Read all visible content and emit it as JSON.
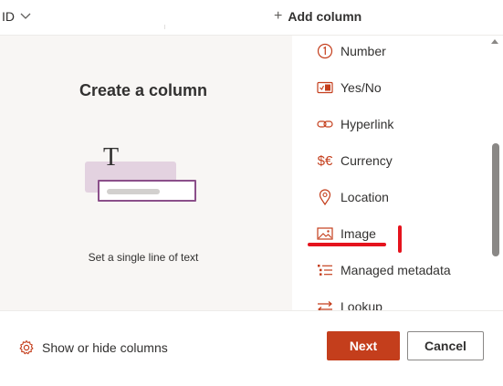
{
  "header": {
    "id_column": "ID",
    "add_column_label": "Add column",
    "add_column_icon": "plus-icon"
  },
  "preview": {
    "title": "Create a column",
    "glyph": "T",
    "description": "Set a single line of text"
  },
  "column_types": [
    {
      "label": "Number",
      "icon": "number-circle-icon"
    },
    {
      "label": "Yes/No",
      "icon": "yes-no-toggle-icon"
    },
    {
      "label": "Hyperlink",
      "icon": "link-icon"
    },
    {
      "label": "Currency",
      "icon": "currency-icon"
    },
    {
      "label": "Location",
      "icon": "location-pin-icon"
    },
    {
      "label": "Image",
      "icon": "image-icon"
    },
    {
      "label": "Managed metadata",
      "icon": "managed-metadata-icon"
    },
    {
      "label": "Lookup",
      "icon": "lookup-arrows-icon"
    }
  ],
  "footer": {
    "show_hide_label": "Show or hide columns",
    "next_label": "Next",
    "cancel_label": "Cancel"
  },
  "colors": {
    "accent": "#c43e1c",
    "annotation": "#e5131d",
    "preview_bg": "#f8f6f4"
  }
}
